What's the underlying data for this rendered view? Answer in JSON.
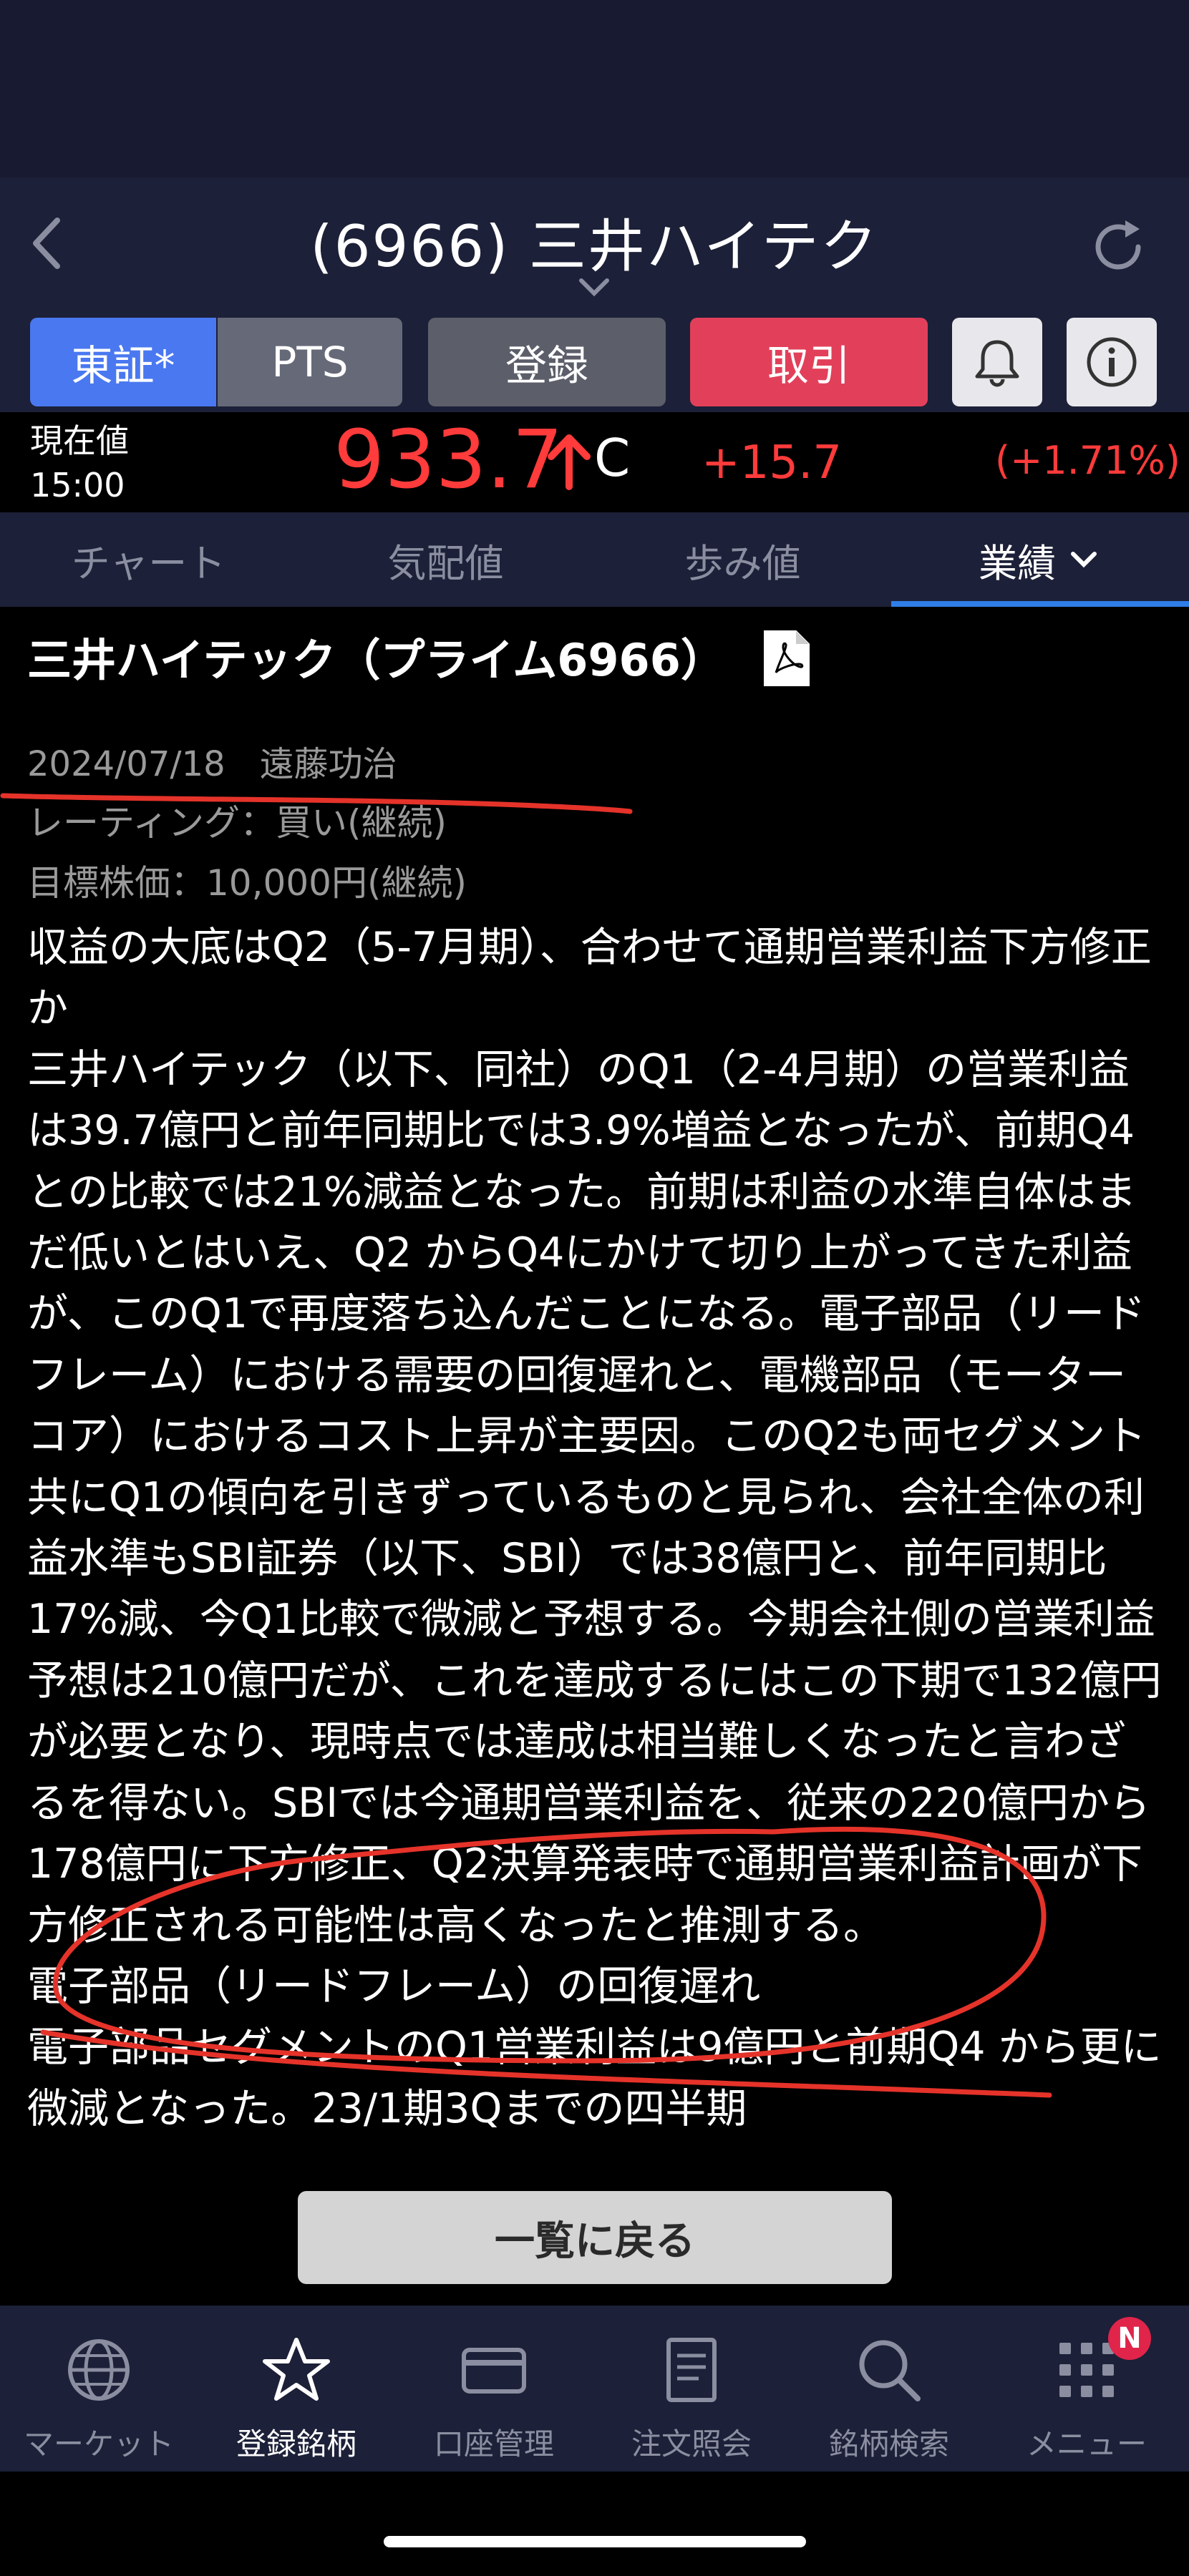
{
  "header": {
    "title": "(6966) 三井ハイテク"
  },
  "buttons": {
    "tosho": "東証*",
    "pts": "PTS",
    "register": "登録",
    "trade": "取引"
  },
  "price": {
    "label_line1": "現在値",
    "label_line2": "15:00",
    "value": "933.7",
    "suffix": "C",
    "change": "+15.7",
    "change_pct": "(+1.71%)",
    "color_up": "#ff3b3b"
  },
  "tabs": [
    {
      "label": "チャート"
    },
    {
      "label": "気配値"
    },
    {
      "label": "歩み値"
    },
    {
      "label": "業績"
    }
  ],
  "report": {
    "title": "三井ハイテック（プライム6966）",
    "date_author": "2024/07/18　遠藤功治",
    "rating": "レーティング：買い(継続)",
    "target_price": "目標株価：10,000円(継続)",
    "headline": "収益の大底はQ2（5-7月期）、合わせて通期営業利益下方修正か",
    "paragraph": "三井ハイテック（以下、同社）のQ1（2-4月期）の営業利益は39.7億円と前年同期比では3.9%増益となったが、前期Q4との比較では21%減益となった。前期は利益の水準自体はまだ低いとはいえ、Q2 からQ4にかけて切り上がってきた利益が、このQ1で再度落ち込んだことになる。電子部品（リードフレーム）における需要の回復遅れと、電機部品（モーターコア）におけるコスト上昇が主要因。このQ2も両セグメント共にQ1の傾向を引きずっているものと見られ、会社全体の利益水準もSBI証券（以下、SBI）では38億円と、前年同期比17%減、今Q1比較で微減と予想する。今期会社側の営業利益予想は210億円だが、これを達成するにはこの下期で132億円が必要となり、現時点では達成は相当難しくなったと言わざるを得ない。SBIでは今通期営業利益を、従来の220億円から178億円に下方修正、Q2決算発表時で通期営業利益計画が下方修正される可能性は高くなったと推測する。",
    "subheading": "電子部品（リードフレーム）の回復遅れ",
    "paragraph2": "電子部品セグメントのQ1営業利益は9億円と前期Q4 から更に微減となった。23/1期3Qまでの四半期"
  },
  "back_to_list": "一覧に戻る",
  "bottom_nav": [
    {
      "label": "マーケット",
      "icon": "globe-icon"
    },
    {
      "label": "登録銘柄",
      "icon": "star-icon"
    },
    {
      "label": "口座管理",
      "icon": "card-icon"
    },
    {
      "label": "注文照会",
      "icon": "document-icon"
    },
    {
      "label": "銘柄検索",
      "icon": "search-icon"
    },
    {
      "label": "メニュー",
      "icon": "grid-icon"
    }
  ],
  "menu_badge": "N",
  "colors": {
    "accent_blue": "#4a78f0",
    "trade_red": "#e2405a",
    "annotation_red": "#e5332a"
  }
}
